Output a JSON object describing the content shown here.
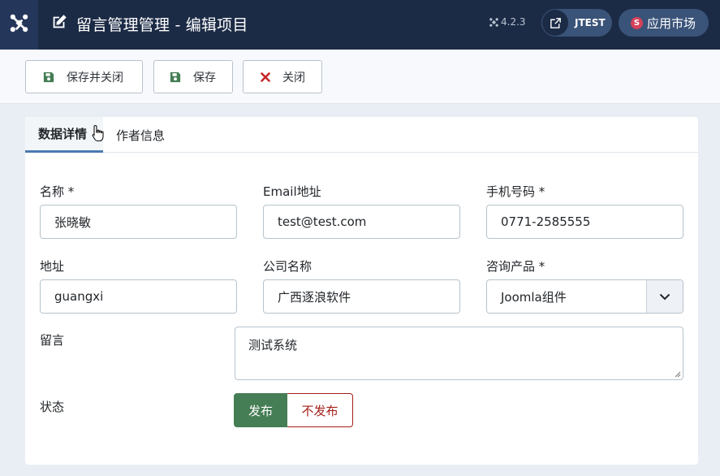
{
  "header": {
    "title": "留言管理管理 - 编辑项目",
    "version": "4.2.3",
    "site_button": "JTEST",
    "app_market_badge": "S",
    "app_market": "应用市场",
    "colors": {
      "bar": "#1c2b45",
      "pill": "#3a5378"
    }
  },
  "toolbar": {
    "save_close_label": "保存并关闭",
    "save_label": "保存",
    "close_label": "关闭"
  },
  "tabs": [
    {
      "label": "数据详情",
      "active": true
    },
    {
      "label": "作者信息",
      "active": false
    }
  ],
  "form": {
    "name_label": "名称 *",
    "name_value": "张晓敏",
    "email_label": "Email地址",
    "email_value": "test@test.com",
    "phone_label": "手机号码 *",
    "phone_value": "0771-2585555",
    "address_label": "地址",
    "address_value": "guangxi",
    "company_label": "公司名称",
    "company_value": "广西逐浪软件",
    "product_label": "咨询产品 *",
    "product_value": "Joomla组件",
    "message_label": "留言",
    "message_value": "测试系统",
    "status_label": "状态",
    "status_on": "发布",
    "status_off": "不发布",
    "status_selected": "发布"
  },
  "icons": {
    "logo": "joomla-logo-icon",
    "title": "edit-icon",
    "version": "joomla-small-icon",
    "site": "external-link-icon",
    "save": "floppy-disk-icon",
    "close": "close-x-icon",
    "select": "chevron-down-icon",
    "cursor": "hand-pointer-icon"
  },
  "accent_colors": {
    "published": "#457d54",
    "unpublished": "#a51f18",
    "tab_active": "#4b79b0"
  }
}
